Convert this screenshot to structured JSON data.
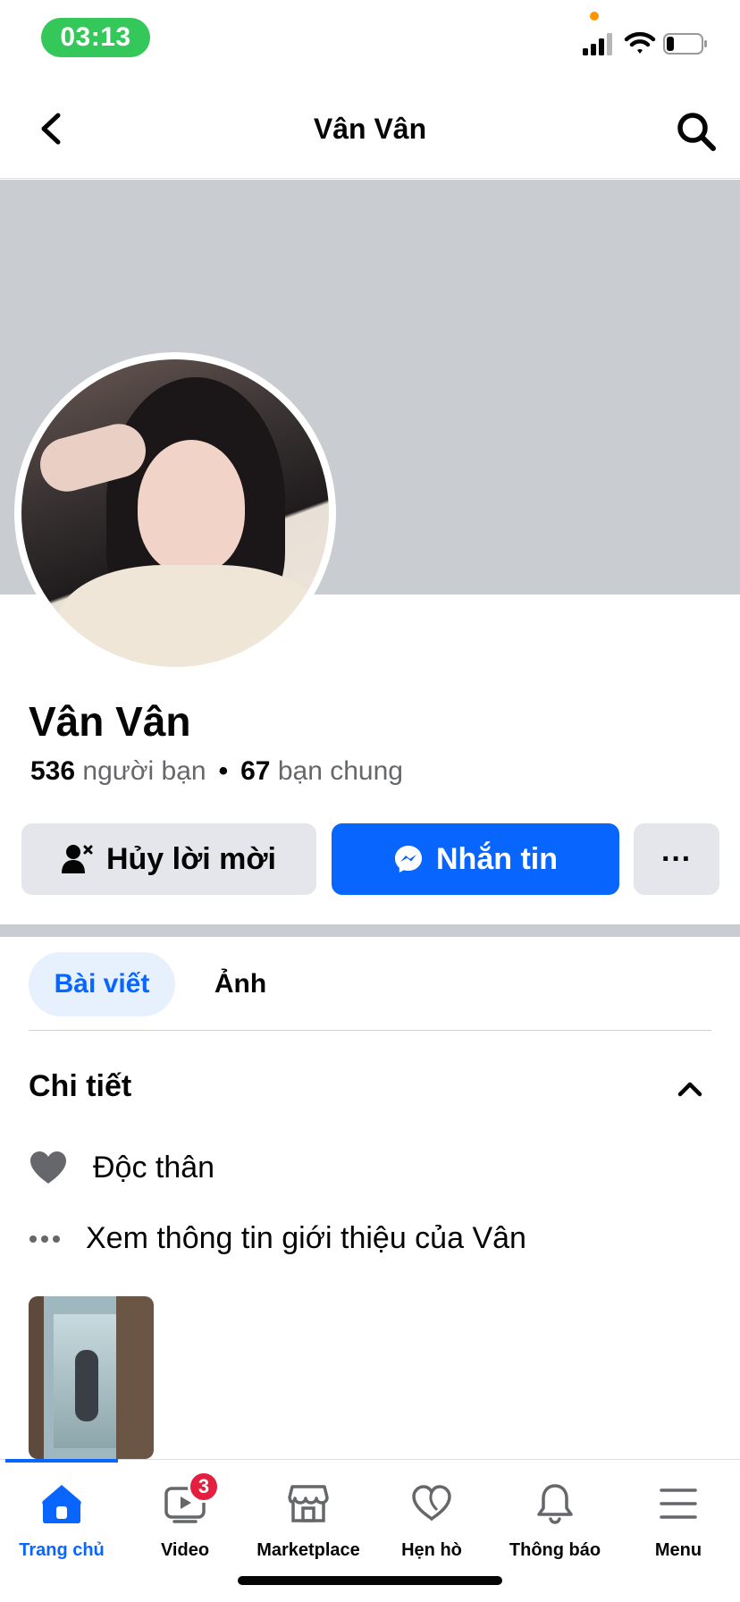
{
  "status_bar": {
    "time": "03:13"
  },
  "header": {
    "title": "Vân Vân"
  },
  "profile": {
    "name": "Vân Vân",
    "friends_count": "536",
    "friends_label": "người bạn",
    "separator": "•",
    "mutual_count": "67",
    "mutual_label": "bạn chung"
  },
  "actions": {
    "cancel_request": "Hủy lời mời",
    "message": "Nhắn tin",
    "more": "···"
  },
  "tabs": [
    {
      "label": "Bài viết",
      "active": true
    },
    {
      "label": "Ảnh",
      "active": false
    }
  ],
  "details": {
    "title": "Chi tiết",
    "relationship": "Độc thân",
    "intro_link": "Xem thông tin giới thiệu của Vân"
  },
  "bottom_nav": [
    {
      "label": "Trang chủ",
      "icon": "home-icon",
      "active": true
    },
    {
      "label": "Video",
      "icon": "video-icon",
      "badge": "3"
    },
    {
      "label": "Marketplace",
      "icon": "marketplace-icon"
    },
    {
      "label": "Hẹn hò",
      "icon": "dating-heart-icon"
    },
    {
      "label": "Thông báo",
      "icon": "bell-icon"
    },
    {
      "label": "Menu",
      "icon": "hamburger-menu-icon"
    }
  ],
  "colors": {
    "accent": "#0866ff",
    "status_green": "#34c759",
    "badge_red": "#e41e3f",
    "cover_gray": "#c9ccd1"
  }
}
